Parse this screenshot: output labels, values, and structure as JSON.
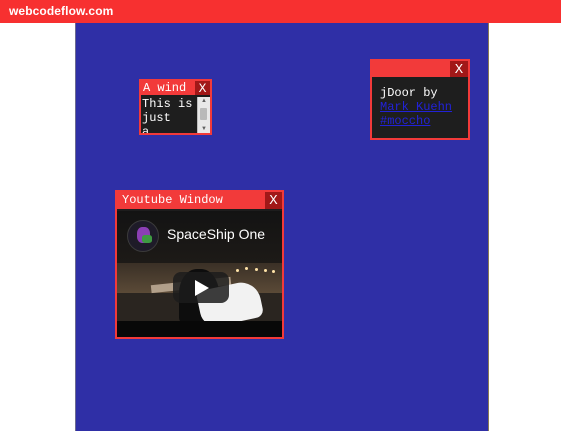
{
  "site": {
    "brand": "webcodeflow.com"
  },
  "colors": {
    "topbar": "#f73030",
    "canvas": "#2f2fa6",
    "window_border": "#f23a3a",
    "window_body": "#1d1d1d",
    "link": "#2222d8"
  },
  "windows": [
    {
      "title": "A wind",
      "close_label": "X",
      "text_lines": [
        "This is",
        "just",
        "a"
      ]
    },
    {
      "title": "",
      "close_label": "X",
      "text": "jDoor by",
      "links": [
        "Mark Kuehn",
        "#moccho"
      ]
    },
    {
      "title": "Youtube Window",
      "close_label": "X",
      "video": {
        "title": "SpaceShip One",
        "play_icon": "play-icon"
      }
    }
  ]
}
